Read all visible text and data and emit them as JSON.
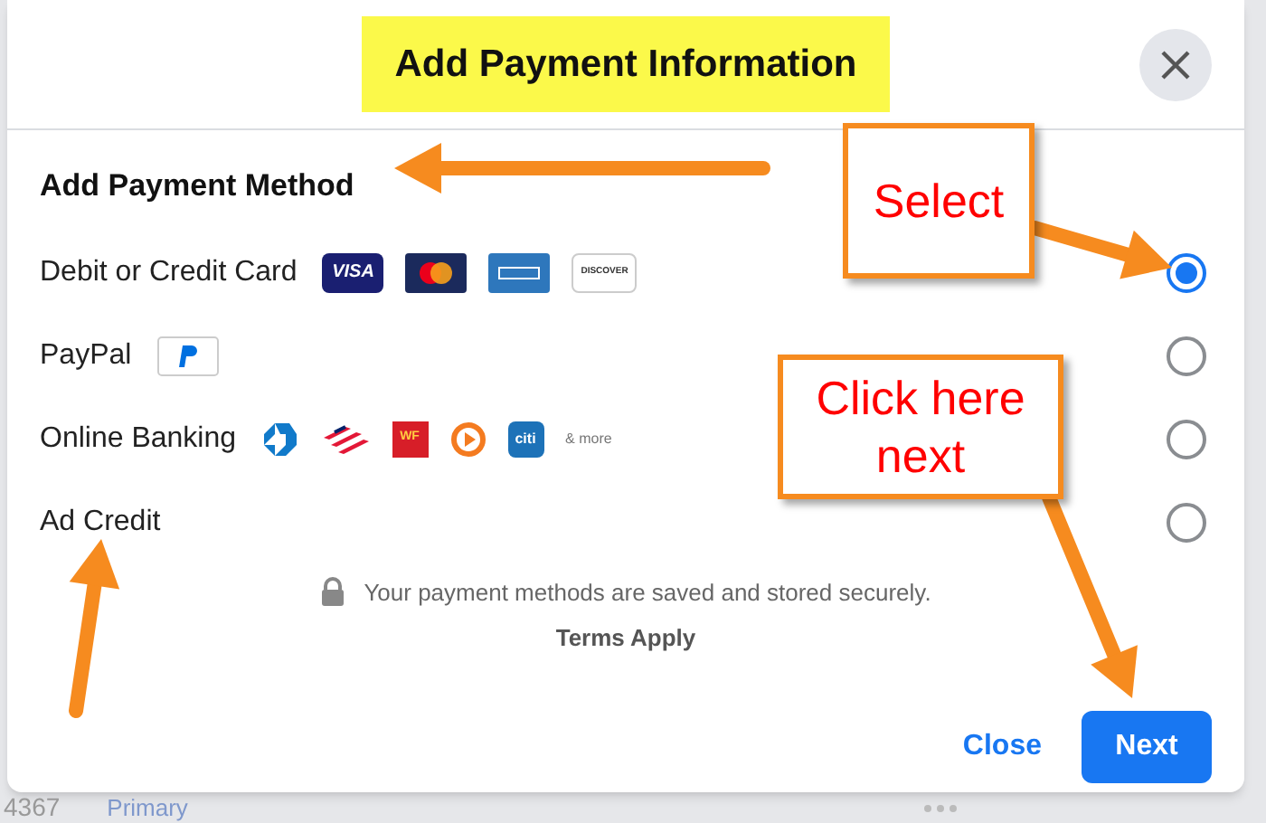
{
  "dialog": {
    "title": "Add Payment Information",
    "section_title": "Add Payment Method",
    "methods": [
      {
        "label": "Debit or Credit Card",
        "selected": true,
        "logos": [
          {
            "kind": "visa",
            "label": "VISA"
          },
          {
            "kind": "mastercard"
          },
          {
            "kind": "amex"
          },
          {
            "kind": "discover",
            "label": "DISCOVER"
          }
        ]
      },
      {
        "label": "PayPal",
        "selected": false,
        "logos": [
          {
            "kind": "paypal"
          }
        ]
      },
      {
        "label": "Online Banking",
        "selected": false,
        "logos": [
          {
            "kind": "chase"
          },
          {
            "kind": "boa"
          },
          {
            "kind": "wf",
            "label": "WF"
          },
          {
            "kind": "play"
          },
          {
            "kind": "citi",
            "label": "citi"
          },
          {
            "kind": "more",
            "label": "& more"
          }
        ]
      },
      {
        "label": "Ad Credit",
        "selected": false
      }
    ],
    "security_note": "Your payment methods are saved and stored securely.",
    "terms": "Terms Apply",
    "buttons": {
      "close": "Close",
      "next": "Next"
    }
  },
  "background": {
    "card_digits": "4367",
    "badge": "Primary"
  },
  "annotations": [
    {
      "text": "Select"
    },
    {
      "text": "Click here next"
    }
  ]
}
